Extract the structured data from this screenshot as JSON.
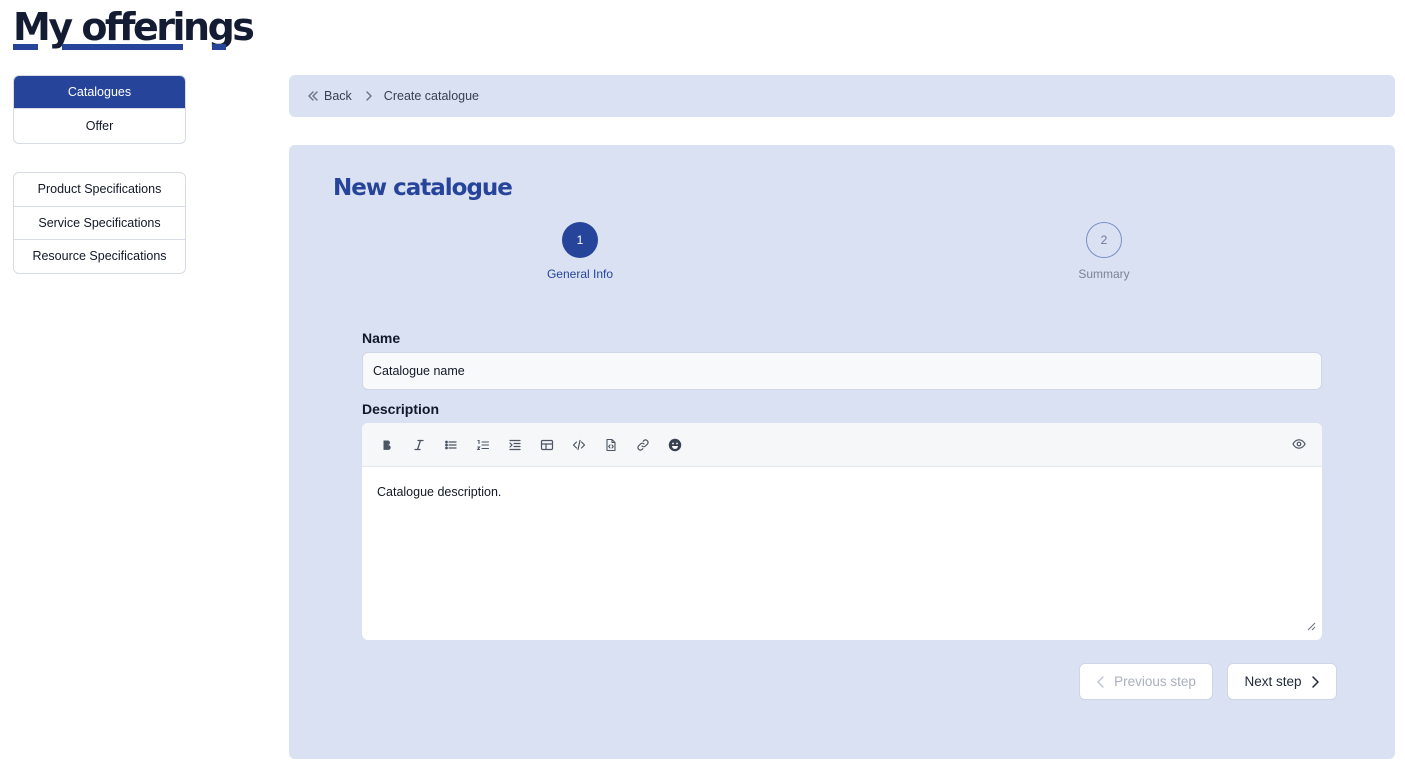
{
  "page": {
    "title": "My offerings"
  },
  "sidebar": {
    "primary": [
      {
        "label": "Catalogues",
        "active": true
      },
      {
        "label": "Offer",
        "active": false
      }
    ],
    "specs": [
      {
        "label": "Product Specifications"
      },
      {
        "label": "Service Specifications"
      },
      {
        "label": "Resource Specifications"
      }
    ]
  },
  "breadcrumb": {
    "back": "Back",
    "current": "Create catalogue"
  },
  "form": {
    "title": "New catalogue",
    "steps": [
      {
        "number": "1",
        "label": "General Info",
        "state": "current"
      },
      {
        "number": "2",
        "label": "Summary",
        "state": "pending"
      }
    ],
    "name": {
      "label": "Name",
      "value": "Catalogue name"
    },
    "description": {
      "label": "Description",
      "value": "Catalogue description.",
      "toolbar": [
        "bold-icon",
        "italic-icon",
        "bullet-list-icon",
        "numbered-list-icon",
        "indent-icon",
        "table-icon",
        "code-icon",
        "file-code-icon",
        "link-icon",
        "emoji-icon"
      ],
      "preview_icon": "eye-icon"
    },
    "buttons": {
      "previous": "Previous step",
      "next": "Next step"
    }
  },
  "colors": {
    "accent": "#26449a",
    "panel_bg": "#d9e1f3",
    "title_dark": "#131c33"
  }
}
